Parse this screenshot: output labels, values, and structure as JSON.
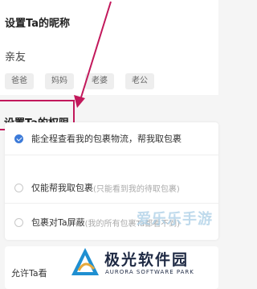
{
  "nickname": {
    "title": "设置Ta的昵称",
    "value": "亲友",
    "tags": [
      "爸爸",
      "妈妈",
      "老婆",
      "老公"
    ]
  },
  "permissions": {
    "title": "设置Ta的权限",
    "options": [
      {
        "label": "能全程查看我的包裹物流，帮我取包裹",
        "hint": "",
        "checked": true
      },
      {
        "label": "仅能帮我取包裹",
        "hint": "(只能看到我的待取包裹)",
        "checked": false
      },
      {
        "label": "包裹对Ta屏蔽",
        "hint": "(我的所有包裹Ta都看不到)",
        "checked": false
      }
    ],
    "selected_color": "#3d7bd9"
  },
  "bottom": {
    "label": "允许Ta看"
  },
  "annotation": {
    "highlight_color": "#c2185b"
  },
  "watermark": {
    "text": "爱乐乐手游",
    "brand": "极光软件园",
    "brand_en": "AURORA SOFTWARE PARK"
  }
}
